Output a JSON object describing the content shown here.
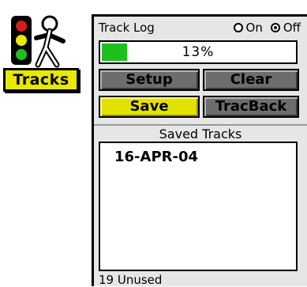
{
  "app": {
    "label": "Tracks",
    "icon": "tracks-app-icon",
    "accent_color": "#e8e800"
  },
  "track_log": {
    "title": "Track Log",
    "options": [
      {
        "label": "On",
        "selected": false
      },
      {
        "label": "Off",
        "selected": true
      }
    ],
    "progress_percent": 13,
    "progress_text": "13%",
    "progress_color": "#1fbf1f"
  },
  "buttons": {
    "setup": "Setup",
    "clear": "Clear",
    "save": "Save",
    "traceback": "TracBack"
  },
  "saved_tracks": {
    "title": "Saved Tracks",
    "items": [
      "16-APR-04"
    ],
    "footer": "19 Unused"
  }
}
